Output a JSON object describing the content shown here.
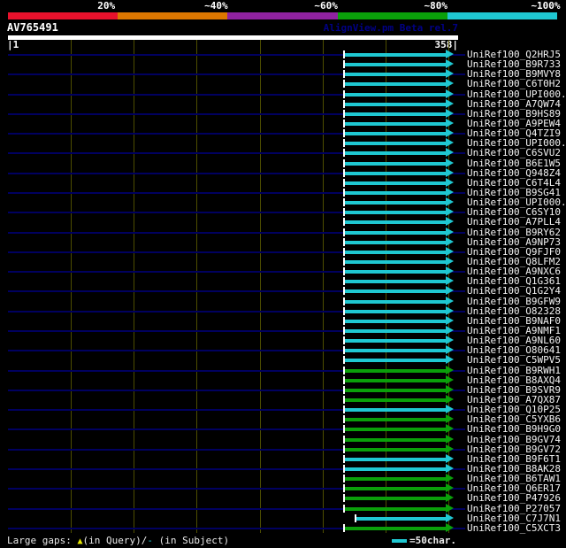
{
  "title_bar": {
    "query_id": "AV765491",
    "watermark": "AlignView.pm Beta rel.7"
  },
  "identity_key": {
    "segments": [
      {
        "label": "20%",
        "color": "#e8112c"
      },
      {
        "label": "~40%",
        "color": "#dd7700"
      },
      {
        "label": "~60%",
        "color": "#9022a0"
      },
      {
        "label": "~80%",
        "color": "#0aa00a"
      },
      {
        "label": "~100%",
        "color": "#1fc8d2"
      }
    ]
  },
  "ruler": {
    "left_label": "|1",
    "right_label": "358|"
  },
  "footer": {
    "large_gaps": {
      "prefix": "Large gaps: ",
      "query_symbol": "▲",
      "query_symbol_color": "#e8e800",
      "query_text": "(in Query)/",
      "subject_symbol": "-",
      "subject_symbol_color": "#1fc8d2",
      "subject_text": " (in Subject)"
    },
    "scale_legend": {
      "swatch_color": "#1fc8d2",
      "label": "=50char."
    }
  },
  "chart_data": {
    "type": "bar",
    "title": "AV765491",
    "query_id": "AV765491",
    "query_length": 358,
    "x_axis": {
      "min": 1,
      "max": 358,
      "tick_labels": [
        "1",
        "358"
      ],
      "gridline_every_chars": 50,
      "grid": true
    },
    "legend": {
      "cyan": "~100% identity",
      "green": "~80% identity",
      "scale_marker": "=50char."
    },
    "palette": {
      "cyan": "#1fc8d2",
      "green": "#0aa00a",
      "row_guide": "#000060",
      "gridline": "#4e4e00"
    },
    "hits": [
      {
        "label": "UniRef100_Q2HRJ5",
        "color": "cyan",
        "query_start": 269,
        "query_end": 358
      },
      {
        "label": "UniRef100_B9R733",
        "color": "cyan",
        "query_start": 269,
        "query_end": 358
      },
      {
        "label": "UniRef100_B9MVY8",
        "color": "cyan",
        "query_start": 269,
        "query_end": 358
      },
      {
        "label": "UniRef100_C6T0H2",
        "color": "cyan",
        "query_start": 269,
        "query_end": 358
      },
      {
        "label": "UniRef100_UPI000..",
        "color": "cyan",
        "query_start": 269,
        "query_end": 358
      },
      {
        "label": "UniRef100_A7QW74",
        "color": "cyan",
        "query_start": 269,
        "query_end": 358
      },
      {
        "label": "UniRef100_B9HS89",
        "color": "cyan",
        "query_start": 269,
        "query_end": 358
      },
      {
        "label": "UniRef100_A9PEW4",
        "color": "cyan",
        "query_start": 269,
        "query_end": 358
      },
      {
        "label": "UniRef100_Q4TZI9",
        "color": "cyan",
        "query_start": 269,
        "query_end": 358
      },
      {
        "label": "UniRef100_UPI000..",
        "color": "cyan",
        "query_start": 269,
        "query_end": 358
      },
      {
        "label": "UniRef100_C6SVU2",
        "color": "cyan",
        "query_start": 269,
        "query_end": 358
      },
      {
        "label": "UniRef100_B6E1W5",
        "color": "cyan",
        "query_start": 269,
        "query_end": 358
      },
      {
        "label": "UniRef100_Q948Z4",
        "color": "cyan",
        "query_start": 269,
        "query_end": 358
      },
      {
        "label": "UniRef100_C6T4L4",
        "color": "cyan",
        "query_start": 269,
        "query_end": 358
      },
      {
        "label": "UniRef100_B9SG41",
        "color": "cyan",
        "query_start": 269,
        "query_end": 358
      },
      {
        "label": "UniRef100_UPI000..",
        "color": "cyan",
        "query_start": 269,
        "query_end": 358
      },
      {
        "label": "UniRef100_C6SY10",
        "color": "cyan",
        "query_start": 269,
        "query_end": 358
      },
      {
        "label": "UniRef100_A7PLL4",
        "color": "cyan",
        "query_start": 269,
        "query_end": 358
      },
      {
        "label": "UniRef100_B9RY62",
        "color": "cyan",
        "query_start": 269,
        "query_end": 358
      },
      {
        "label": "UniRef100_A9NP73",
        "color": "cyan",
        "query_start": 269,
        "query_end": 358
      },
      {
        "label": "UniRef100_Q9FJF0",
        "color": "cyan",
        "query_start": 269,
        "query_end": 358
      },
      {
        "label": "UniRef100_Q8LFM2",
        "color": "cyan",
        "query_start": 269,
        "query_end": 358
      },
      {
        "label": "UniRef100_A9NXC6",
        "color": "cyan",
        "query_start": 269,
        "query_end": 358
      },
      {
        "label": "UniRef100_Q1G361",
        "color": "cyan",
        "query_start": 269,
        "query_end": 358
      },
      {
        "label": "UniRef100_Q1G2Y4",
        "color": "cyan",
        "query_start": 269,
        "query_end": 358
      },
      {
        "label": "UniRef100_B9GFW9",
        "color": "cyan",
        "query_start": 269,
        "query_end": 358
      },
      {
        "label": "UniRef100_O82328",
        "color": "cyan",
        "query_start": 269,
        "query_end": 358
      },
      {
        "label": "UniRef100_B9NAF0",
        "color": "cyan",
        "query_start": 269,
        "query_end": 358
      },
      {
        "label": "UniRef100_A9NMF1",
        "color": "cyan",
        "query_start": 269,
        "query_end": 358
      },
      {
        "label": "UniRef100_A9NL60",
        "color": "cyan",
        "query_start": 269,
        "query_end": 358
      },
      {
        "label": "UniRef100_O80641",
        "color": "cyan",
        "query_start": 269,
        "query_end": 358
      },
      {
        "label": "UniRef100_C5WPV5",
        "color": "cyan",
        "query_start": 269,
        "query_end": 358
      },
      {
        "label": "UniRef100_B9RWH1",
        "color": "green",
        "query_start": 269,
        "query_end": 358
      },
      {
        "label": "UniRef100_B8AXQ4",
        "color": "green",
        "query_start": 269,
        "query_end": 358
      },
      {
        "label": "UniRef100_B9SVR9",
        "color": "green",
        "query_start": 269,
        "query_end": 358
      },
      {
        "label": "UniRef100_A7QX87",
        "color": "green",
        "query_start": 269,
        "query_end": 358
      },
      {
        "label": "UniRef100_Q10P25",
        "color": "cyan",
        "query_start": 269,
        "query_end": 358
      },
      {
        "label": "UniRef100_C5YXB6",
        "color": "green",
        "query_start": 269,
        "query_end": 358
      },
      {
        "label": "UniRef100_B9H9G0",
        "color": "green",
        "query_start": 269,
        "query_end": 358
      },
      {
        "label": "UniRef100_B9GV74",
        "color": "green",
        "query_start": 269,
        "query_end": 358
      },
      {
        "label": "UniRef100_B9GV72",
        "color": "green",
        "query_start": 269,
        "query_end": 358
      },
      {
        "label": "UniRef100_B9F6T1",
        "color": "cyan",
        "query_start": 269,
        "query_end": 358
      },
      {
        "label": "UniRef100_B8AK28",
        "color": "cyan",
        "query_start": 269,
        "query_end": 358
      },
      {
        "label": "UniRef100_B6TAW1",
        "color": "green",
        "query_start": 269,
        "query_end": 358
      },
      {
        "label": "UniRef100_Q6ER17",
        "color": "green",
        "query_start": 269,
        "query_end": 358
      },
      {
        "label": "UniRef100_P47926",
        "color": "green",
        "query_start": 269,
        "query_end": 358
      },
      {
        "label": "UniRef100_P27057",
        "color": "green",
        "query_start": 269,
        "query_end": 358
      },
      {
        "label": "UniRef100_C7J7N1",
        "color": "cyan",
        "query_start": 278,
        "query_end": 358
      },
      {
        "label": "UniRef100_C5XCT3",
        "color": "green",
        "query_start": 269,
        "query_end": 358
      }
    ]
  }
}
